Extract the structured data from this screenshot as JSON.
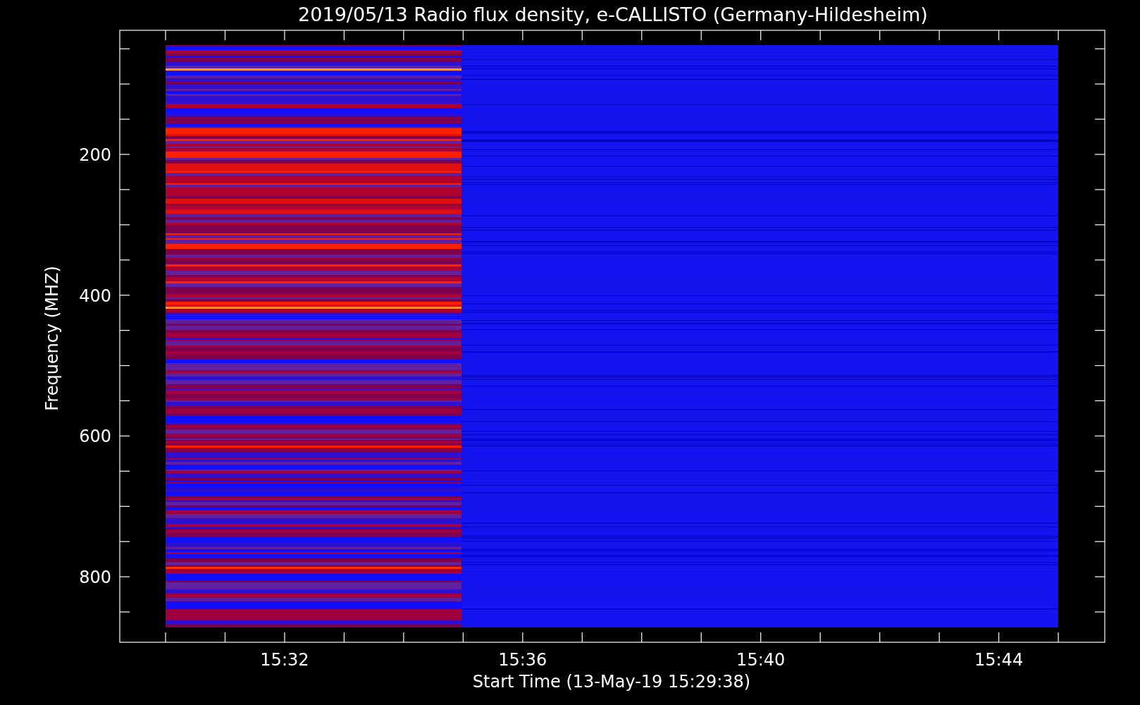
{
  "title": "2019/05/13  Radio flux density, e-CALLISTO (Germany-Hildesheim)",
  "y_axis": {
    "label": "Frequency (MHZ)",
    "ticks": [
      "200",
      "400",
      "600",
      "800"
    ]
  },
  "x_axis": {
    "label": "Start Time (13-May-19 15:29:38)",
    "ticks": [
      "15:32",
      "15:36",
      "15:40",
      "15:44"
    ]
  }
}
